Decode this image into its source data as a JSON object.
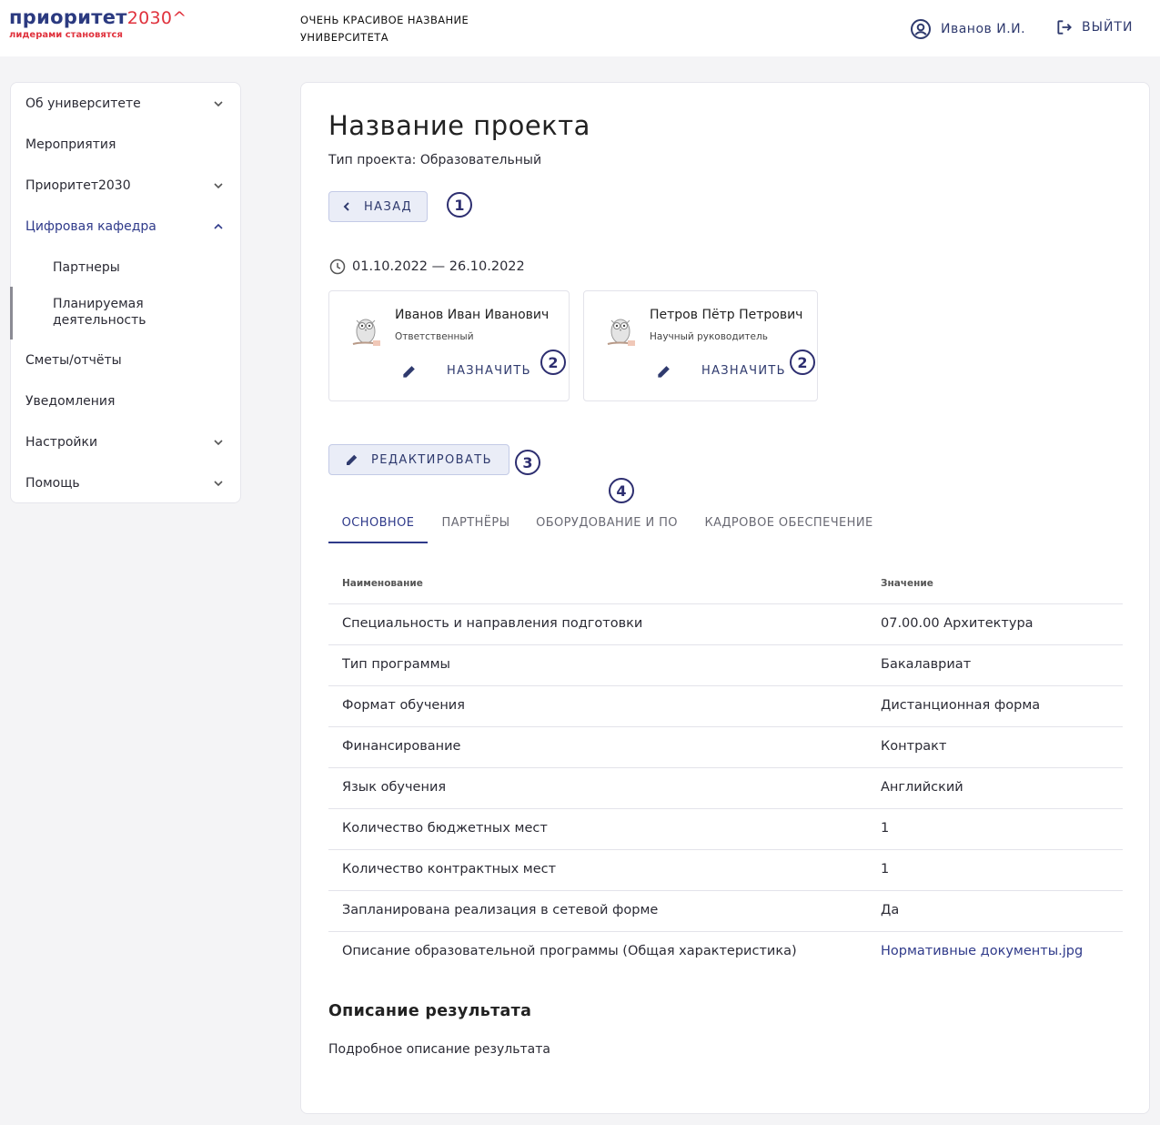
{
  "header": {
    "logo_main": "приоритет",
    "logo_num": "2030^",
    "logo_sub": "лидерами становятся",
    "university": "ОЧЕНЬ КРАСИВОЕ НАЗВАНИЕ УНИВЕРСИТЕТА",
    "user_name": "Иванов И.И.",
    "logout_label": "ВЫЙТИ",
    "icons": {
      "user": "account-circle-icon",
      "logout": "logout-icon"
    }
  },
  "sidebar": {
    "items": [
      {
        "label": "Об университете",
        "expandable": true,
        "expanded": false
      },
      {
        "label": "Мероприятия",
        "expandable": false
      },
      {
        "label": "Приоритет2030",
        "expandable": true,
        "expanded": false
      },
      {
        "label": "Цифровая кафедра",
        "expandable": true,
        "expanded": true,
        "active": true
      },
      {
        "label": "Партнеры",
        "sub": true
      },
      {
        "label": "Планируемая деятельность",
        "sub": true,
        "selected": true
      },
      {
        "label": "Сметы/отчёты",
        "expandable": false
      },
      {
        "label": "Уведомления",
        "expandable": false
      },
      {
        "label": "Настройки",
        "expandable": true,
        "expanded": false
      },
      {
        "label": "Помощь",
        "expandable": true,
        "expanded": false
      }
    ]
  },
  "project": {
    "title": "Название проекта",
    "type_text": "Тип проекта: Образовательный",
    "back_label": "НАЗАД",
    "dates": "01.10.2022 — 26.10.2022",
    "edit_label": "РЕДАКТИРОВАТЬ",
    "badges": [
      "1",
      "2",
      "3",
      "4"
    ],
    "people": [
      {
        "name": "Иванов Иван Иванович",
        "role": "Ответственный",
        "assign_label": "НАЗНАЧИТЬ"
      },
      {
        "name": "Петров Пётр Петрович",
        "role": "Научный руководитель",
        "assign_label": "НАЗНАЧИТЬ"
      }
    ],
    "tabs": [
      {
        "label": "ОСНОВНОЕ",
        "active": true
      },
      {
        "label": "ПАРТНЁРЫ"
      },
      {
        "label": "ОБОРУДОВАНИЕ И ПО"
      },
      {
        "label": "КАДРОВОЕ ОБЕСПЕЧЕНИЕ"
      }
    ],
    "table": {
      "headers": [
        "Наименование",
        "Значение"
      ],
      "rows": [
        [
          "Специальность и направления подготовки",
          "07.00.00 Архитектура"
        ],
        [
          "Тип программы",
          "Бакалавриат"
        ],
        [
          "Формат обучения",
          "Дистанционная форма"
        ],
        [
          "Финансирование",
          "Контракт"
        ],
        [
          "Язык обучения",
          "Английский"
        ],
        [
          "Количество бюджетных мест",
          "1"
        ],
        [
          "Количество контрактных мест",
          "1"
        ],
        [
          "Запланирована реализация в сетевой форме",
          "Да"
        ],
        [
          "Описание образовательной программы (Общая характеристика)",
          "Нормативные документы.jpg"
        ]
      ]
    },
    "result_title": "Описание результата",
    "result_desc": "Подробное описание результата"
  },
  "colors": {
    "brand_blue": "#2b3a80",
    "brand_red": "#e0323d",
    "accent": "#2f3a8a",
    "button_bg": "#eaedf7",
    "badge": "#2d2e70"
  }
}
